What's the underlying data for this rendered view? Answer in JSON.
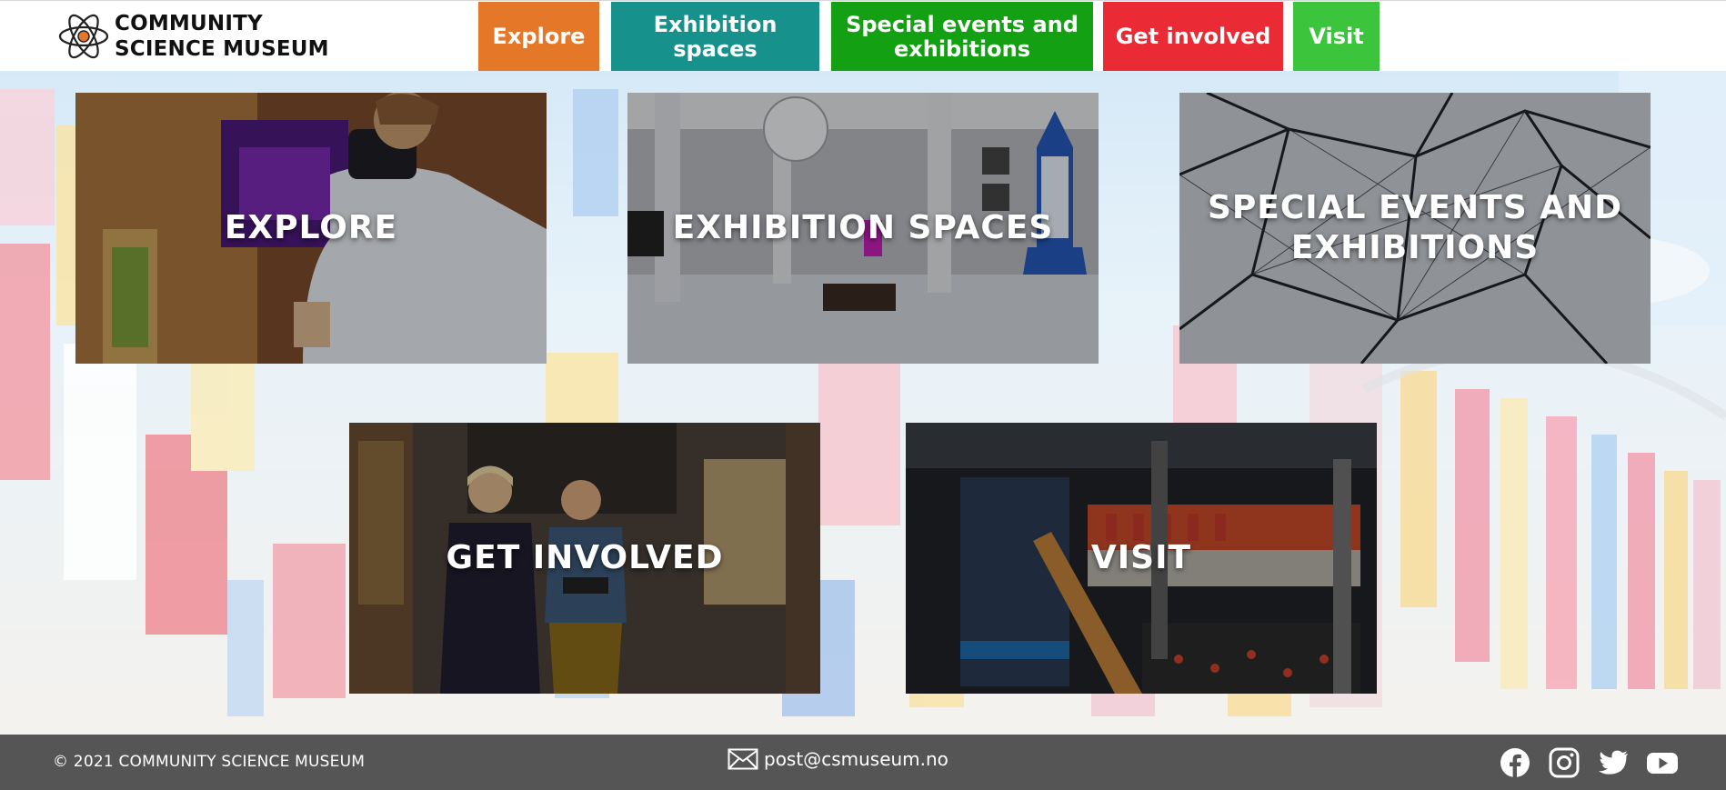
{
  "site": {
    "name_line1": "COMMUNITY",
    "name_line2": "SCIENCE MUSEUM",
    "logo_icon": "atom-icon"
  },
  "nav": [
    {
      "label": "Explore",
      "color": "#e57828"
    },
    {
      "label": "Exhibition spaces",
      "color": "#17918c"
    },
    {
      "label": "Special events and exhibitions",
      "color": "#13a113"
    },
    {
      "label": "Get involved",
      "color": "#ea2a35"
    },
    {
      "label": "Visit",
      "color": "#3cc43c"
    }
  ],
  "cards": [
    {
      "title": "EXPLORE",
      "image": "person-in-vr-headset-painting"
    },
    {
      "title": "EXHIBITION SPACES",
      "image": "museum-gallery-hall-with-rocket"
    },
    {
      "title": "SPECIAL EVENTS AND EXHIBITIONS",
      "image": "geometric-cable-structure"
    },
    {
      "title": "GET INVOLVED",
      "image": "two-people-talking-in-art-gallery"
    },
    {
      "title": "VISIT",
      "image": "library-atrium-with-staircase"
    }
  ],
  "footer": {
    "copyright": "© 2021 COMMUNITY SCIENCE MUSEUM",
    "email": "post@csmuseum.no",
    "email_icon": "envelope-icon",
    "social_icons": [
      "facebook-icon",
      "instagram-icon",
      "twitter-icon",
      "youtube-icon"
    ],
    "background": "#555555"
  }
}
